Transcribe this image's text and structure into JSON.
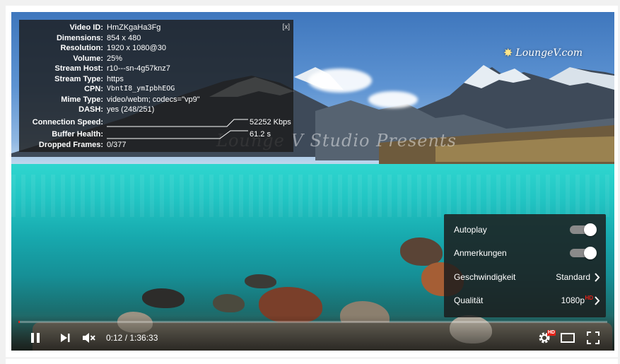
{
  "stats": {
    "close_label": "[x]",
    "rows": [
      {
        "label": "Video ID:",
        "value": "HmZKgaHa3Fg"
      },
      {
        "label": "Dimensions:",
        "value": "854 x 480"
      },
      {
        "label": "Resolution:",
        "value": "1920 x 1080@30"
      },
      {
        "label": "Volume:",
        "value": "25%"
      },
      {
        "label": "Stream Host:",
        "value": "r10---sn-4g57knz7"
      },
      {
        "label": "Stream Type:",
        "value": "https"
      },
      {
        "label": "CPN:",
        "value": "VbntI8_ymIpbhEOG"
      },
      {
        "label": "Mime Type:",
        "value": "video/webm; codecs=\"vp9\""
      },
      {
        "label": "DASH:",
        "value": "yes (248/251)"
      }
    ],
    "connection_speed_label": "Connection Speed:",
    "connection_speed_value": "52252 Kbps",
    "buffer_health_label": "Buffer Health:",
    "buffer_health_value": "61.2 s",
    "dropped_frames_label": "Dropped Frames:",
    "dropped_frames_value": "0/377"
  },
  "overlay": {
    "studio_text": "Lounge V Studio Presents",
    "logo_text": "LoungeV.com"
  },
  "settings_menu": {
    "autoplay_label": "Autoplay",
    "autoplay_on": true,
    "annotations_label": "Anmerkungen",
    "annotations_on": true,
    "speed_label": "Geschwindigkeit",
    "speed_value": "Standard",
    "quality_label": "Qualität",
    "quality_value": "1080p",
    "quality_badge": "HD"
  },
  "controls": {
    "time_display": "0:12 / 1:36:33",
    "progress_fraction": 0.0021,
    "settings_badge": "HD"
  },
  "icons": {
    "play_pause": "pause-icon",
    "next": "next-icon",
    "volume": "mute-icon",
    "settings": "gear-icon",
    "theater": "theater-mode-icon",
    "fullscreen": "fullscreen-icon"
  },
  "colors": {
    "accent_red": "#e62117",
    "overlay_bg": "#1c1c1c"
  }
}
